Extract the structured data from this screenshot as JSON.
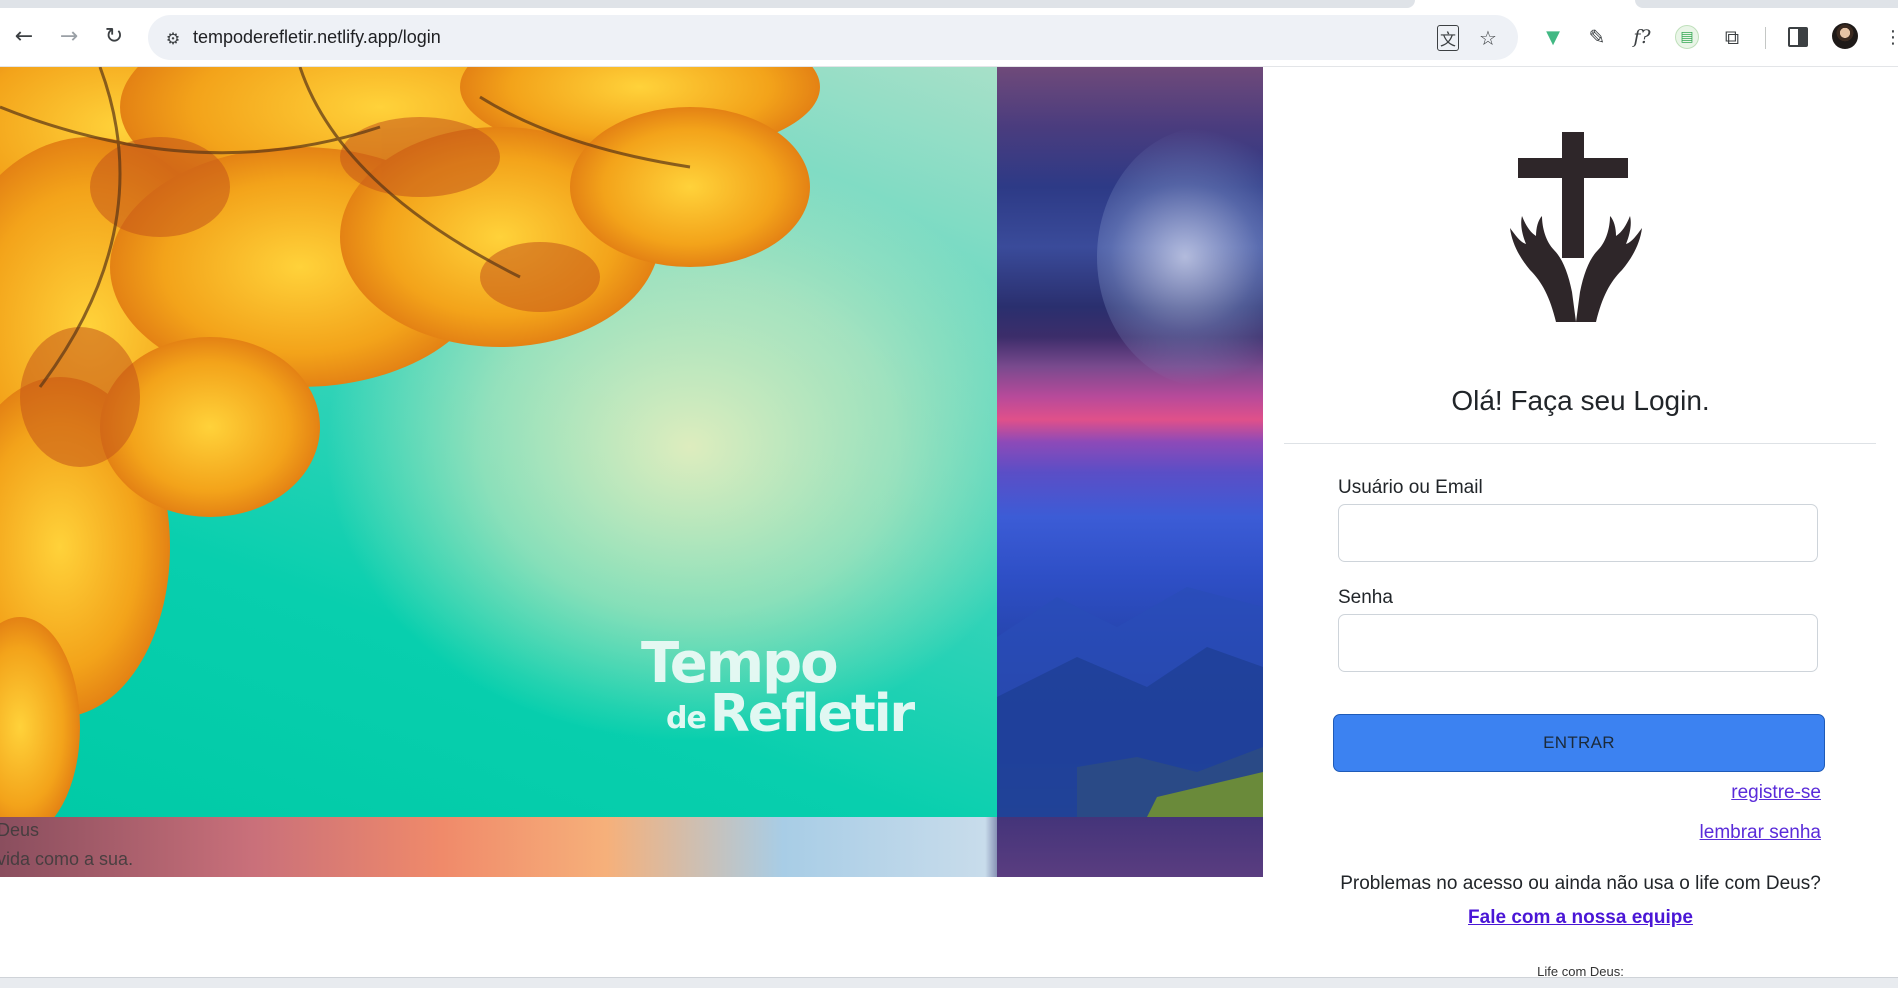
{
  "browser": {
    "url": "tempoderefletir.netlify.app/login",
    "icons": {
      "back": "arrow-left-icon",
      "forward": "arrow-right-icon",
      "reload": "reload-icon",
      "site_info": "tune-icon",
      "translate": "translate-icon",
      "bookmark": "star-icon"
    }
  },
  "extensions": [
    {
      "name": "vue-devtools-icon",
      "glyph": "▼",
      "color": "#41b883"
    },
    {
      "name": "color-picker-icon",
      "glyph": "✎",
      "color": "#202124"
    },
    {
      "name": "font-identifier-icon",
      "glyph": "f?",
      "color": "#202124"
    },
    {
      "name": "sheets-extension-icon",
      "glyph": "▤",
      "color": "#34a853"
    },
    {
      "name": "extensions-puzzle-icon",
      "glyph": "⧉",
      "color": "#3c4043"
    }
  ],
  "hero": {
    "logo_line1": "Tempo",
    "logo_de": "de",
    "logo_line2": "Refletir",
    "strip_line1": "Deus",
    "strip_line2": "vida como a sua."
  },
  "login": {
    "title": "Olá! Faça seu Login.",
    "username_label": "Usuário ou Email",
    "username_value": "",
    "password_label": "Senha",
    "password_value": "",
    "submit_label": "ENTRAR",
    "register_link": "registre-se",
    "forgot_link": "lembrar senha",
    "help_text": "Problemas no acesso ou ainda não usa o life com Deus?",
    "contact_link": "Fale com a nossa equipe",
    "footer": "Life com Deus:"
  },
  "colors": {
    "primary_button": "#3c82f1",
    "link": "#5a2bd9"
  }
}
